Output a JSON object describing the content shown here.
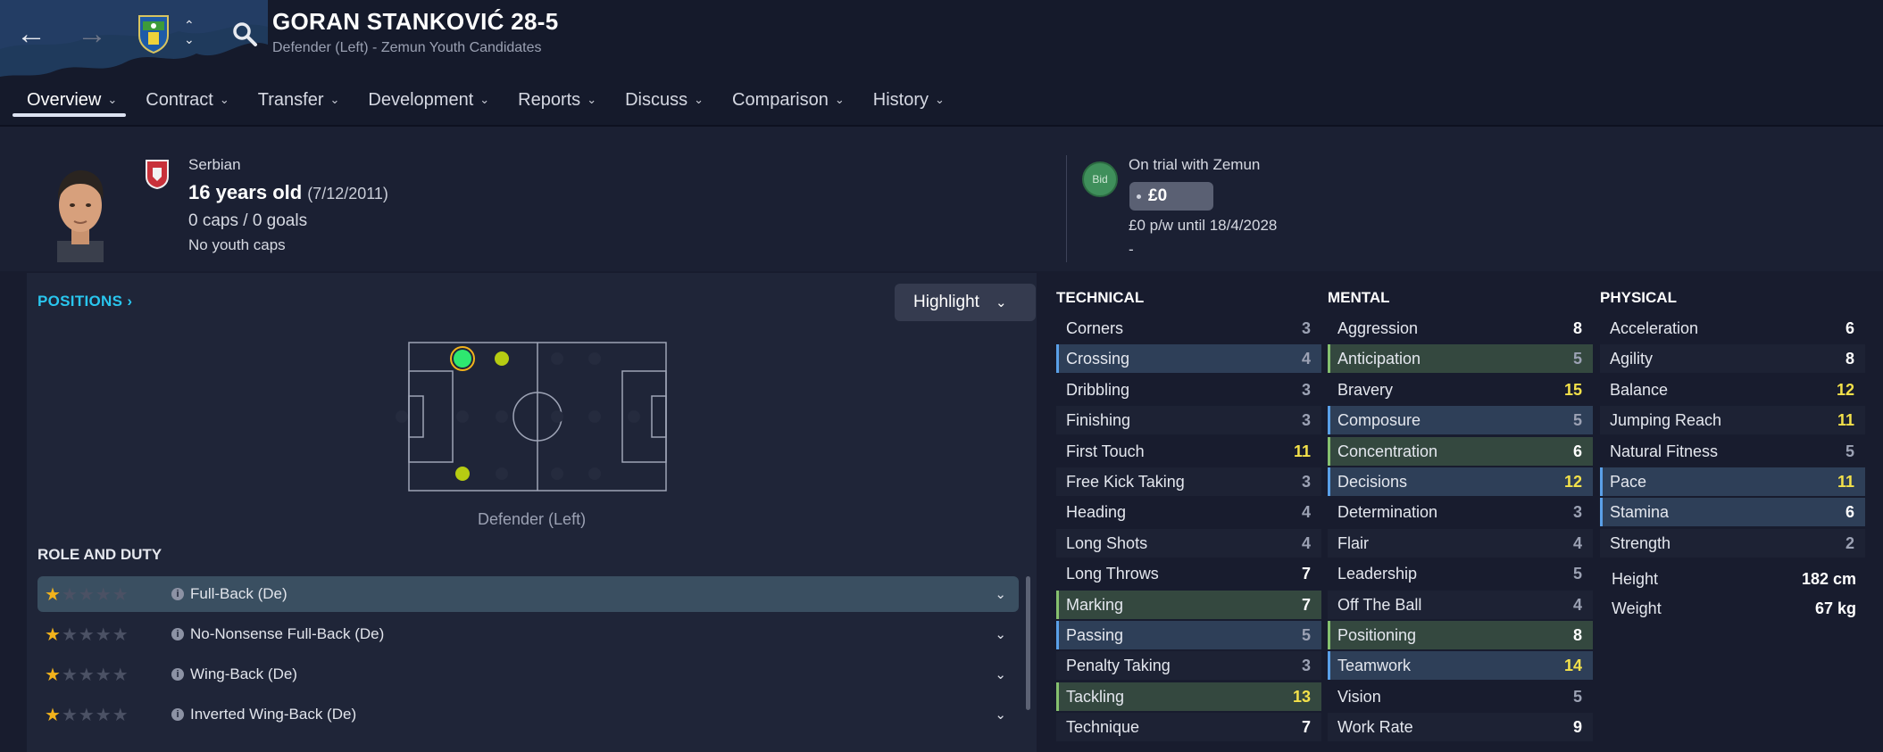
{
  "header": {
    "title": "GORAN STANKOVIĆ 28-5",
    "subtitle": "Defender (Left) - Zemun Youth Candidates",
    "nav": {
      "back_icon": "arrow-left-icon",
      "forward_icon": "arrow-right-icon",
      "search_icon": "search-icon"
    }
  },
  "tabs": [
    {
      "label": "Overview",
      "active": true
    },
    {
      "label": "Contract"
    },
    {
      "label": "Transfer"
    },
    {
      "label": "Development"
    },
    {
      "label": "Reports"
    },
    {
      "label": "Discuss"
    },
    {
      "label": "Comparison"
    },
    {
      "label": "History"
    }
  ],
  "profile": {
    "nationality": "Serbian",
    "age": "16 years old",
    "dob": "(7/12/2011)",
    "caps": "0 caps / 0 goals",
    "youth_caps": "No youth caps"
  },
  "contract": {
    "bid_label": "Bid",
    "status": "On trial with Zemun",
    "value": "£0",
    "wage": "£0 p/w until 18/4/2028",
    "extra": "-"
  },
  "positions": {
    "title": "POSITIONS",
    "highlight_label": "Highlight",
    "position_label": "Defender (Left)"
  },
  "roles": {
    "title": "ROLE AND DUTY",
    "items": [
      {
        "label": "Full-Back (De)",
        "stars": 1,
        "selected": true
      },
      {
        "label": "No-Nonsense Full-Back (De)",
        "stars": 1
      },
      {
        "label": "Wing-Back (De)",
        "stars": 1
      },
      {
        "label": "Inverted Wing-Back (De)",
        "stars": 1
      }
    ]
  },
  "attributes": {
    "technical": {
      "title": "TECHNICAL",
      "items": [
        {
          "label": "Corners",
          "value": "3"
        },
        {
          "label": "Crossing",
          "value": "4",
          "hl": "blue"
        },
        {
          "label": "Dribbling",
          "value": "3"
        },
        {
          "label": "Finishing",
          "value": "3"
        },
        {
          "label": "First Touch",
          "value": "11"
        },
        {
          "label": "Free Kick Taking",
          "value": "3"
        },
        {
          "label": "Heading",
          "value": "4"
        },
        {
          "label": "Long Shots",
          "value": "4"
        },
        {
          "label": "Long Throws",
          "value": "7"
        },
        {
          "label": "Marking",
          "value": "7",
          "hl": "green"
        },
        {
          "label": "Passing",
          "value": "5",
          "hl": "blue"
        },
        {
          "label": "Penalty Taking",
          "value": "3"
        },
        {
          "label": "Tackling",
          "value": "13",
          "hl": "green"
        },
        {
          "label": "Technique",
          "value": "7"
        }
      ]
    },
    "mental": {
      "title": "MENTAL",
      "items": [
        {
          "label": "Aggression",
          "value": "8"
        },
        {
          "label": "Anticipation",
          "value": "5",
          "hl": "green"
        },
        {
          "label": "Bravery",
          "value": "15"
        },
        {
          "label": "Composure",
          "value": "5",
          "hl": "blue"
        },
        {
          "label": "Concentration",
          "value": "6",
          "hl": "green"
        },
        {
          "label": "Decisions",
          "value": "12",
          "hl": "blue"
        },
        {
          "label": "Determination",
          "value": "3"
        },
        {
          "label": "Flair",
          "value": "4"
        },
        {
          "label": "Leadership",
          "value": "5"
        },
        {
          "label": "Off The Ball",
          "value": "4"
        },
        {
          "label": "Positioning",
          "value": "8",
          "hl": "green"
        },
        {
          "label": "Teamwork",
          "value": "14",
          "hl": "blue"
        },
        {
          "label": "Vision",
          "value": "5"
        },
        {
          "label": "Work Rate",
          "value": "9"
        }
      ]
    },
    "physical": {
      "title": "PHYSICAL",
      "items": [
        {
          "label": "Acceleration",
          "value": "6"
        },
        {
          "label": "Agility",
          "value": "8"
        },
        {
          "label": "Balance",
          "value": "12"
        },
        {
          "label": "Jumping Reach",
          "value": "11"
        },
        {
          "label": "Natural Fitness",
          "value": "5"
        },
        {
          "label": "Pace",
          "value": "11",
          "hl": "blue"
        },
        {
          "label": "Stamina",
          "value": "6",
          "hl": "blue"
        },
        {
          "label": "Strength",
          "value": "2"
        }
      ]
    },
    "misc": [
      {
        "label": "Height",
        "value": "182 cm"
      },
      {
        "label": "Weight",
        "value": "67 kg"
      }
    ]
  },
  "colors": {
    "accent": "#29c6ee",
    "star": "#f2b31c",
    "high_value": "#f3e14a",
    "bid": "#3f8f5b"
  }
}
